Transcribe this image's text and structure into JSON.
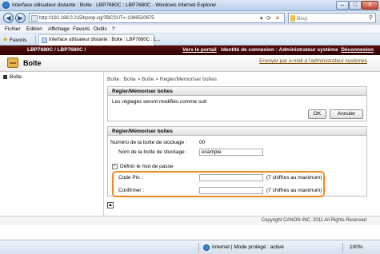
{
  "window": {
    "title": "Interface utilisateur distante : Boite : LBP7680C : LBP7680C - Windows Internet Explorer",
    "minimize": "–",
    "maximize": "□",
    "close": "✕"
  },
  "address_bar": {
    "back": "◀",
    "forward": "▶",
    "url": "http://192.168.0.215/bprop.cgi?BiCSUT=-1066520675",
    "search_placeholder": "Bing"
  },
  "menu": [
    "Fichier",
    "Edition",
    "Affichage",
    "Favoris",
    "Outils",
    "?"
  ],
  "favorites": {
    "label": "Favoris",
    "tab_title": "Interface utilisateur distante : Boite : LBP7680C : L..."
  },
  "header": {
    "model": "LBP7680C / LBP7680C /",
    "portal_link": "Vers le portail",
    "login_info": "Identité de connexion : Administrateur système",
    "logout_link": "Déconnexion",
    "page_title": "Boîte",
    "email_link": "Envoyer par e-mail à l'administrateur systèmes"
  },
  "sidebar": {
    "items": [
      {
        "label": "Boîte"
      }
    ]
  },
  "breadcrumb": "Boîte : Boîte > Boîte > Régler/Mémoriser boîtes",
  "panel1": {
    "heading": "Régler/Mémoriser boîtes",
    "message": "Les réglages seront modifiés comme suit",
    "ok_label": "OK",
    "cancel_label": "Annuler"
  },
  "panel2": {
    "heading": "Régler/Mémoriser boîtes",
    "box_number_label": "Numéro de la boîte de stockage :",
    "box_number_value": "00",
    "box_name_label": "Nom de la boîte de stockage :",
    "box_name_value": "example",
    "password_checkbox_label": "Définir le mot de passe",
    "password_checked": true,
    "pin_label": "Code Pin :",
    "pin_hint": "(7 chiffres au maximum)",
    "confirm_label": "Confirmer :",
    "confirm_hint": "(7 chiffres au maximum)",
    "highlight_color": "#f08a1e"
  },
  "footer": {
    "copyright": "Copyright CANON INC. 2011 All Rights Reserved"
  },
  "status": {
    "zone": "Internet | Mode protégé : activé",
    "zoom": "100%"
  },
  "colors": {
    "header_bar": "#3d0606",
    "highlight": "#f08a1e"
  }
}
